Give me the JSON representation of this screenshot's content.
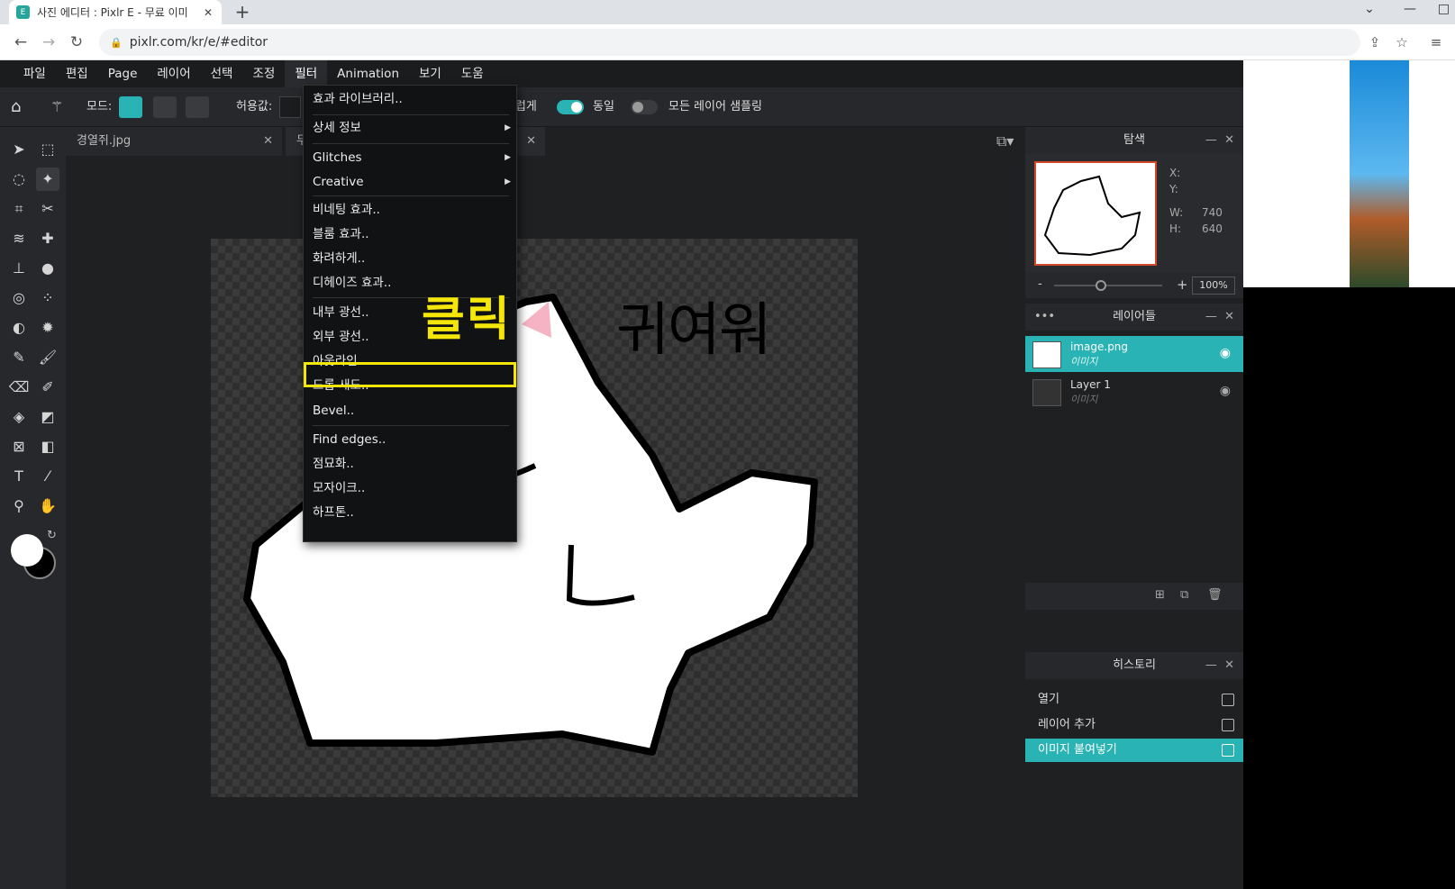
{
  "browser": {
    "tab_title": "사진 에디터 : Pixlr E - 무료 이미",
    "tab_close": "✕",
    "new_tab": "+",
    "url": "pixlr.com/kr/e/#editor"
  },
  "menu": [
    "파일",
    "편집",
    "Page",
    "레이어",
    "선택",
    "조정",
    "필터",
    "Animation",
    "보기",
    "도움"
  ],
  "active_menu": "필터",
  "tool_options": {
    "mode_label": "모드:",
    "tolerance_label": "허용값:",
    "smooth_label": "부드럽게",
    "contiguous_label": "동일",
    "sample_all_label": "모든 레이어 샘플링"
  },
  "doc_tabs": [
    "경열쥐.jpg",
    "무제"
  ],
  "filter_menu": {
    "items": [
      "효과 라이브러리..",
      "상세 정보",
      "Glitches",
      "Creative",
      "비네팅 효과..",
      "블룸 효과..",
      "화려하게..",
      "디헤이즈 효과..",
      "내부 광선..",
      "외부 광선..",
      "아웃라인..",
      "드롭 새도..",
      "Bevel..",
      "Find edges..",
      "점묘화..",
      "모자이크..",
      "하프톤.."
    ],
    "highlighted": "아웃라인.."
  },
  "annotation": "클릭",
  "canvas_text": "귀여워",
  "navigator": {
    "title": "탐색",
    "x_label": "X:",
    "y_label": "Y:",
    "w_label": "W:",
    "w_value": "740",
    "h_label": "H:",
    "h_value": "640",
    "zoom": "100%",
    "minus": "-",
    "plus": "+"
  },
  "layers": {
    "title": "레이어들",
    "items": [
      {
        "name": "image.png",
        "type": "이미지"
      },
      {
        "name": "Layer 1",
        "type": "이미지"
      }
    ]
  },
  "history": {
    "title": "히스토리",
    "items": [
      "열기",
      "레이어 추가",
      "이미지 붙여넣기"
    ]
  },
  "colors": {
    "accent": "#2ab3b4",
    "highlight": "#f5e60a",
    "panel": "#27282b"
  }
}
